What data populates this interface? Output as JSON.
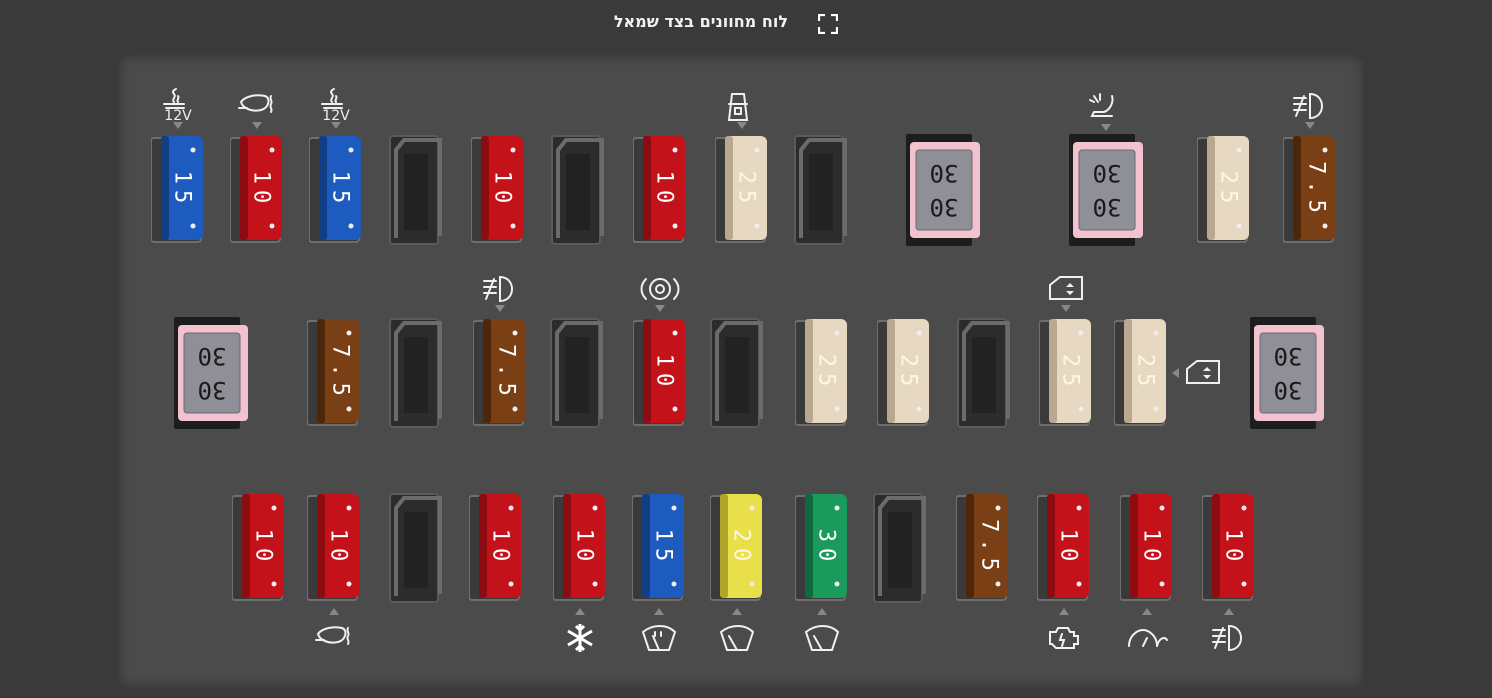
{
  "header": {
    "title": "לוח מחוונים בצד שמאל",
    "fullscreen_icon": "fullscreen-icon"
  },
  "colors": {
    "page_bg": "#3a3a3a",
    "panel_bg": "#4b4b4b",
    "fuse_red": "#c4121a",
    "fuse_blue": "#1e5bbf",
    "fuse_beige": "#e7d8c2",
    "fuse_brown": "#7a3f14",
    "fuse_yellow": "#e9df4a",
    "fuse_green": "#1a9a5c",
    "fuse_pink": "#f2c2cf"
  },
  "fuses": {
    "r1": [
      {
        "value": "15",
        "color": "blue",
        "icon": "cigarette-lighter-icon",
        "icon_text": "12V",
        "icon_pos": "top"
      },
      {
        "value": "10",
        "color": "red",
        "icon": "heated-mirror-icon",
        "icon_pos": "top"
      },
      {
        "value": "15",
        "color": "blue",
        "icon": "cigarette-lighter-icon",
        "icon_text": "12V",
        "icon_pos": "top"
      },
      {
        "value": "",
        "color": "empty"
      },
      {
        "value": "10",
        "color": "red"
      },
      {
        "value": "",
        "color": "empty"
      },
      {
        "value": "10",
        "color": "red"
      },
      {
        "value": "25",
        "color": "beige",
        "icon": "door-lock-icon",
        "icon_pos": "top"
      },
      {
        "value": "",
        "color": "empty"
      },
      {
        "value": "30",
        "color": "pink",
        "size": "large"
      },
      {
        "value": "30",
        "color": "pink",
        "size": "large",
        "icon": "power-seat-icon",
        "icon_pos": "top"
      },
      {
        "value": "25",
        "color": "beige"
      },
      {
        "value": "7.5",
        "color": "brown",
        "icon": "fog-light-icon",
        "icon_pos": "top"
      }
    ],
    "r2": [
      {
        "value": "30",
        "color": "pink",
        "size": "large"
      },
      {
        "value": "7.5",
        "color": "brown"
      },
      {
        "value": "",
        "color": "empty"
      },
      {
        "value": "7.5",
        "color": "brown",
        "icon": "fog-light-icon",
        "icon_pos": "top"
      },
      {
        "value": "",
        "color": "empty"
      },
      {
        "value": "10",
        "color": "red",
        "icon": "parking-brake-icon",
        "icon_pos": "top"
      },
      {
        "value": "",
        "color": "empty"
      },
      {
        "value": "25",
        "color": "beige"
      },
      {
        "value": "25",
        "color": "beige"
      },
      {
        "value": "",
        "color": "empty"
      },
      {
        "value": "25",
        "color": "beige",
        "icon": "power-window-icon",
        "icon_pos": "top"
      },
      {
        "value": "25",
        "color": "beige",
        "icon": "power-window-icon",
        "icon_pos": "right"
      },
      {
        "value": "30",
        "color": "pink",
        "size": "large"
      }
    ],
    "r3": [
      {
        "value": "10",
        "color": "red"
      },
      {
        "value": "10",
        "color": "red",
        "icon": "heated-mirror-icon",
        "icon_pos": "bottom"
      },
      {
        "value": "",
        "color": "empty"
      },
      {
        "value": "10",
        "color": "red"
      },
      {
        "value": "10",
        "color": "red",
        "icon": "ac-snowflake-icon",
        "icon_pos": "bottom"
      },
      {
        "value": "15",
        "color": "blue",
        "icon": "windshield-washer-icon",
        "icon_pos": "bottom"
      },
      {
        "value": "20",
        "color": "yellow",
        "icon": "wiper-icon",
        "icon_pos": "bottom"
      },
      {
        "value": "30",
        "color": "green",
        "icon": "wiper-icon",
        "icon_pos": "bottom"
      },
      {
        "value": "",
        "color": "empty"
      },
      {
        "value": "7.5",
        "color": "brown"
      },
      {
        "value": "10",
        "color": "red",
        "icon": "engine-check-icon",
        "icon_pos": "bottom"
      },
      {
        "value": "10",
        "color": "red",
        "icon": "instrument-cluster-icon",
        "icon_pos": "bottom"
      },
      {
        "value": "10",
        "color": "red",
        "icon": "fog-light-icon",
        "icon_pos": "bottom"
      }
    ]
  }
}
